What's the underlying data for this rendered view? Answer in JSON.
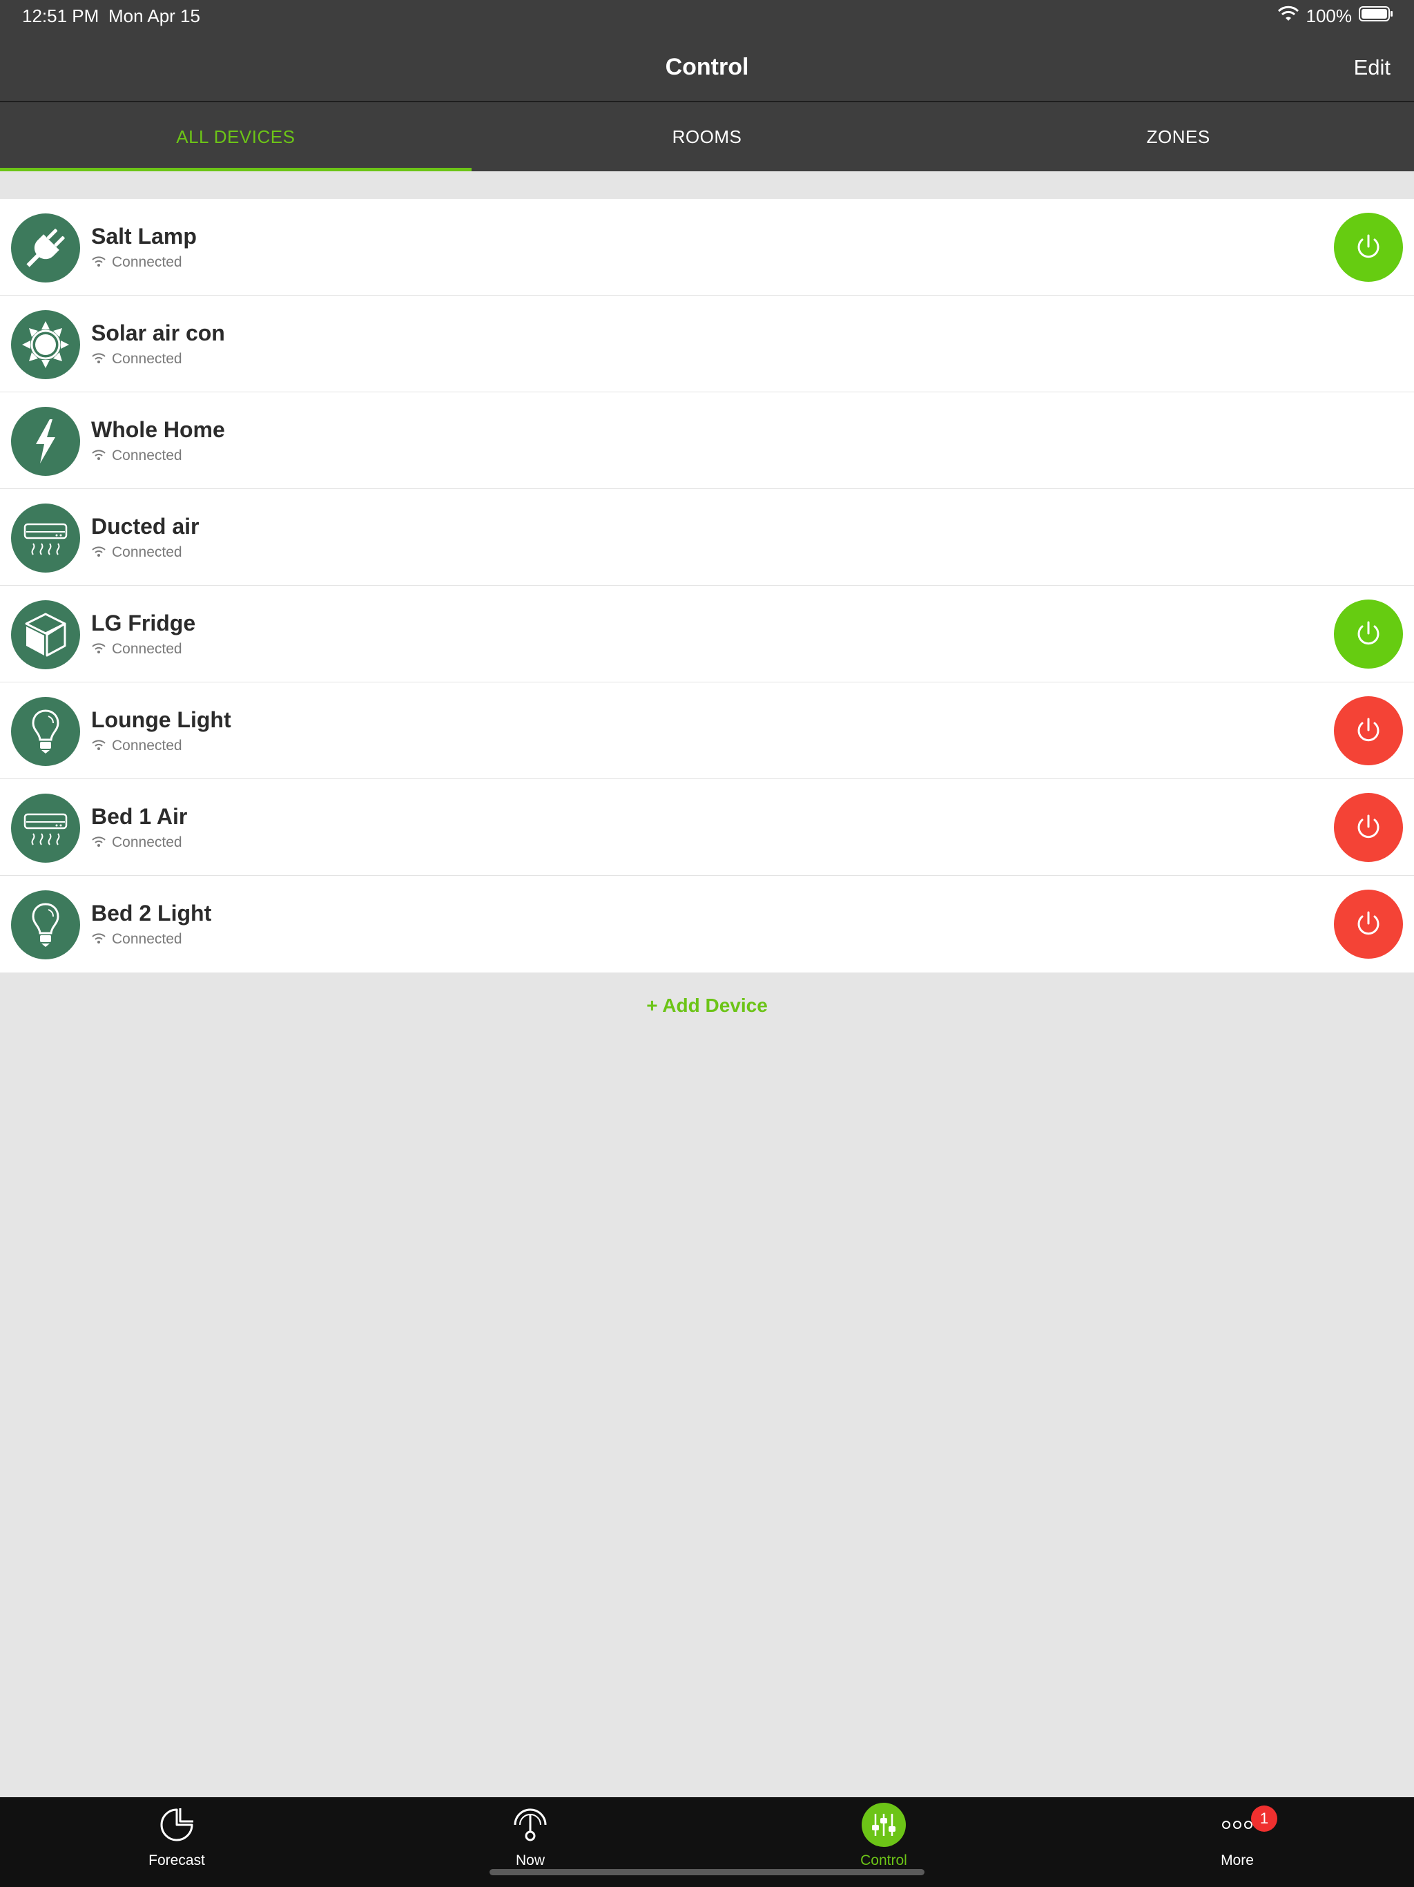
{
  "status_bar": {
    "time": "12:51 PM",
    "date": "Mon Apr 15",
    "battery": "100%"
  },
  "nav": {
    "title": "Control",
    "edit_label": "Edit"
  },
  "tabs": [
    {
      "label": "ALL DEVICES",
      "active": true
    },
    {
      "label": "ROOMS",
      "active": false
    },
    {
      "label": "ZONES",
      "active": false
    }
  ],
  "devices": [
    {
      "name": "Salt Lamp",
      "status": "Connected",
      "icon": "plug-icon",
      "power": "on"
    },
    {
      "name": "Solar air con",
      "status": "Connected",
      "icon": "sun-icon",
      "power": null
    },
    {
      "name": "Whole Home",
      "status": "Connected",
      "icon": "lightning-icon",
      "power": null
    },
    {
      "name": "Ducted air",
      "status": "Connected",
      "icon": "air-conditioner-icon",
      "power": null
    },
    {
      "name": "LG Fridge",
      "status": "Connected",
      "icon": "box-icon",
      "power": "on"
    },
    {
      "name": "Lounge Light",
      "status": "Connected",
      "icon": "lightbulb-icon",
      "power": "off"
    },
    {
      "name": "Bed 1 Air",
      "status": "Connected",
      "icon": "air-conditioner-icon",
      "power": "off"
    },
    {
      "name": "Bed 2 Light",
      "status": "Connected",
      "icon": "lightbulb-icon",
      "power": "off"
    }
  ],
  "add_device_label": "+ Add Device",
  "tab_bar": [
    {
      "label": "Forecast",
      "icon": "forecast-icon",
      "active": false
    },
    {
      "label": "Now",
      "icon": "now-icon",
      "active": false
    },
    {
      "label": "Control",
      "icon": "control-icon",
      "active": true
    },
    {
      "label": "More",
      "icon": "more-icon",
      "active": false,
      "badge": "1"
    }
  ],
  "colors": {
    "accent": "#6cc417",
    "power_on": "#66cc11",
    "power_off": "#f44336",
    "icon_bg": "#3d7a5c",
    "header_bg": "#3e3e3e",
    "tabbar_bg": "#111111"
  }
}
